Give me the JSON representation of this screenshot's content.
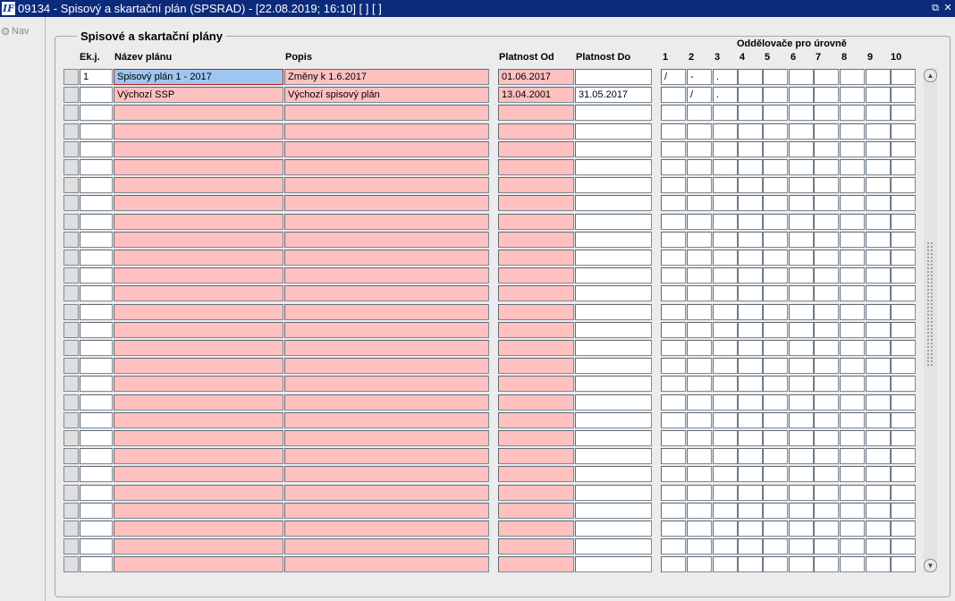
{
  "window": {
    "title": "09134 - Spisový a skartační plán (SPSRAD) - [22.08.2019; 16:10]  [ ]  [ ]",
    "app_icon_text": "IF",
    "restore_glyph": "⧉",
    "close_glyph": "✕"
  },
  "sidebar": {
    "nav_label": "Nav"
  },
  "section": {
    "title": "Spisové a skartační plány"
  },
  "columns": {
    "ekj": "Ek.j.",
    "nazev": "Název plánu",
    "popis": "Popis",
    "platnost_od": "Platnost Od",
    "platnost_do": "Platnost Do",
    "separators_group": "Oddělovače pro úrovně",
    "levels": [
      "1",
      "2",
      "3",
      "4",
      "5",
      "6",
      "7",
      "8",
      "9",
      "10"
    ]
  },
  "rows": [
    {
      "ekj": "1",
      "nazev": "Spisový plán 1 - 2017",
      "popis": "Změny k 1.6.2017",
      "od": "01.06.2017",
      "do": "",
      "seps": [
        "/",
        "-",
        ".",
        "",
        "",
        "",
        "",
        "",
        "",
        ""
      ]
    },
    {
      "ekj": "",
      "nazev": "Výchozí SSP",
      "popis": "Výchozí spisový plán",
      "od": "13.04.2001",
      "do": "31.05.2017",
      "seps": [
        "",
        "/",
        ".",
        "",
        "",
        "",
        "",
        "",
        "",
        ""
      ]
    }
  ],
  "empty_row_count": 26,
  "scrollbar": {
    "up_glyph": "▲",
    "down_glyph": "▼"
  },
  "colors": {
    "required_field": "#ffc0c0",
    "selected_field": "#9ec6f1",
    "title_bar": "#0b2a7a"
  }
}
